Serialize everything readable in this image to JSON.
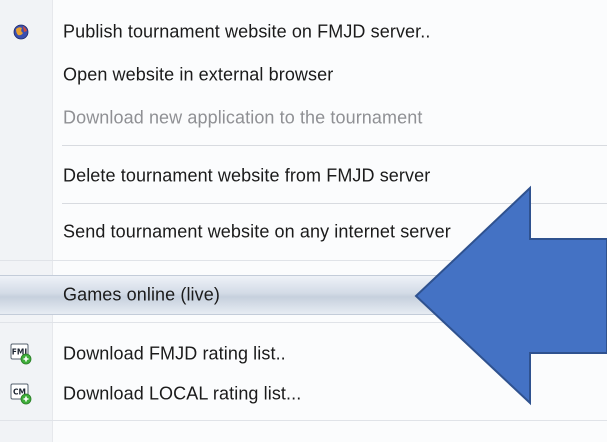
{
  "menu": {
    "items": [
      {
        "label": "Publish tournament website on FMJD server..",
        "enabled": true,
        "icon": "publish-globe-icon"
      },
      {
        "label": "Open website in external browser",
        "enabled": true
      },
      {
        "label": "Download new application to the tournament",
        "enabled": false
      },
      {
        "label": "Delete tournament website from FMJD server",
        "enabled": true
      },
      {
        "label": "Send tournament website on any internet server",
        "enabled": true
      },
      {
        "label": "Games online (live)",
        "enabled": true,
        "highlighted": true
      },
      {
        "label": "Download FMJD rating list..",
        "enabled": true,
        "icon": "fmjd-rating-icon",
        "icon_text": "FMJ"
      },
      {
        "label": "Download LOCAL rating list...",
        "enabled": true,
        "icon": "local-rating-icon",
        "icon_text": "CM"
      }
    ]
  },
  "colors": {
    "arrow_fill": "#4472c4",
    "arrow_stroke": "#2f528f",
    "highlight": "#c6d0dd",
    "disabled_text": "#8f9094"
  }
}
